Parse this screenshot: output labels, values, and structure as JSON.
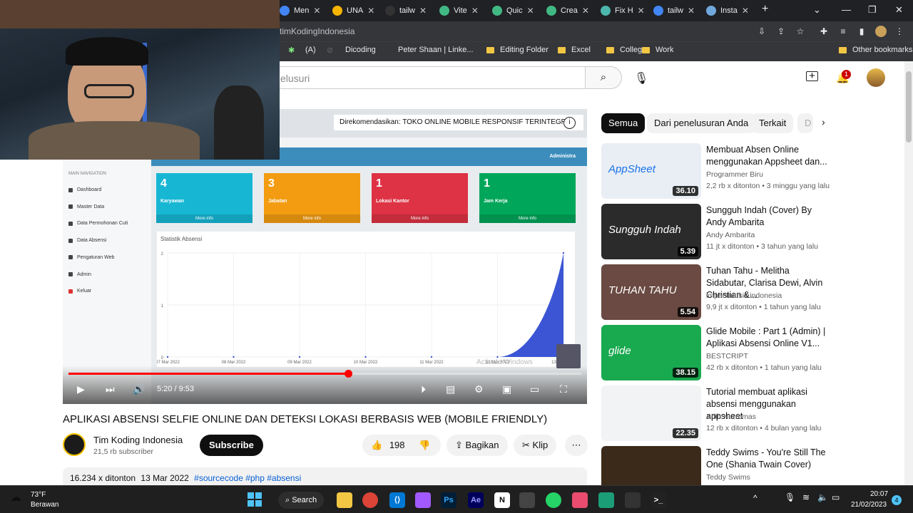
{
  "browser": {
    "tabs": [
      {
        "label": "Men",
        "color": "#4285f4"
      },
      {
        "label": "UNA",
        "color": "#f4b400"
      },
      {
        "label": "tailw",
        "color": "#333"
      },
      {
        "label": "Vite",
        "color": "#41b883"
      },
      {
        "label": "Quic",
        "color": "#41b883"
      },
      {
        "label": "Crea",
        "color": "#41b883"
      },
      {
        "label": "Fix H",
        "color": "#4db6ac"
      },
      {
        "label": "tailw",
        "color": "#4285f4"
      },
      {
        "label": "Insta",
        "color": "#6fa8dc"
      }
    ],
    "address": "timKodingIndonesia",
    "bookmarks": [
      "Dicoding",
      "Peter Shaan | Linke...",
      "Editing Folder",
      "Excel",
      "College",
      "Work",
      "Other bookmarks"
    ]
  },
  "youtube": {
    "search_placeholder": "elusuri",
    "notif_count": "1",
    "video": {
      "title": "APLIKASI ABSENSI SELFIE ONLINE DAN DETEKSI LOKASI BERBASIS WEB (MOBILE FRIENDLY)",
      "time": "5:20 / 9:53",
      "progress": 0.545,
      "recommend": "Direkomendasikan: TOKO ONLINE MOBILE RESPONSIF TERINTEGR...",
      "channel": "Tim Koding Indonesia",
      "subs": "21,5 rb subscriber",
      "subscribe": "Subscribe",
      "likes": "198",
      "share": "Bagikan",
      "clip": "Klip",
      "views": "16.234 x ditonton",
      "date": "13 Mar 2022",
      "tags": "#sourcecode #php #absensi"
    },
    "inner_app": {
      "menu_title": "MAIN NAVIGATION",
      "menu": [
        "Dashboard",
        "Master Data",
        "Data Permohonan Cuti",
        "Data Absensi",
        "Pengaturan Web",
        "Admin",
        "Keluar"
      ],
      "admin": "Administra",
      "boxes": [
        {
          "n": "4",
          "label": "Karyawan",
          "color": "#17b7d4"
        },
        {
          "n": "3",
          "label": "Jabatan",
          "color": "#f39c12"
        },
        {
          "n": "1",
          "label": "Lokasi Kantor",
          "color": "#dd3344"
        },
        {
          "n": "1",
          "label": "Jam Kerja",
          "color": "#00a65a"
        }
      ],
      "more": "More info",
      "chart_title": "Statistik Absensi",
      "windows_watermark": "Activate Windows"
    },
    "chips": [
      "Semua",
      "Dari penelusuran Anda",
      "Terkait",
      "D"
    ],
    "recs": [
      {
        "title": "Membuat Absen Online menggunakan Appsheet dan...",
        "channel": "Programmer Biru",
        "meta": "2,2 rb x ditonton  •  3 minggu yang lalu",
        "dur": "36.10",
        "bg": "#e9eef5",
        "label": "AppSheet"
      },
      {
        "title": "Sungguh Indah (Cover) By Andy Ambarita",
        "channel": "Andy Ambarita",
        "meta": "11 jt x ditonton  •  3 tahun yang lalu",
        "dur": "5.39",
        "bg": "#2b2b2b",
        "label": "Sungguh Indah"
      },
      {
        "title": "Tuhan Tahu - Melitha Sidabutar, Clarisa Dewi, Alvin Christian &...",
        "channel": "impactmusik indonesia",
        "meta": "9,9 jt x ditonton  •  1 tahun yang lalu",
        "dur": "5.54",
        "bg": "#6a4a42",
        "label": "TUHAN TAHU"
      },
      {
        "title": "Glide Mobile : Part 1 (Admin) | Aplikasi Absensi Online V1...",
        "channel": "BESTCRIPT",
        "meta": "42 rb x ditonton  •  1 tahun yang lalu",
        "dur": "38.15",
        "bg": "#19a94f",
        "label": "glide"
      },
      {
        "title": "Tutorial membuat aplikasi absensi menggunakan appsheet",
        "channel": "Adib Nurromas",
        "meta": "12 rb x ditonton  •  4 bulan yang lalu",
        "dur": "22.35",
        "bg": "#f1f3f4",
        "label": ""
      },
      {
        "title": "Teddy Swims - You're Still The One (Shania Twain Cover)",
        "channel": "Teddy Swims",
        "meta": "",
        "dur": "",
        "bg": "#3b2a1a",
        "label": ""
      }
    ]
  },
  "taskbar": {
    "temp": "73°F",
    "weather": "Berawan",
    "search": "Search",
    "time": "20:07",
    "date": "21/02/2023",
    "notif": "4"
  },
  "chart_data": {
    "type": "area",
    "title": "Statistik Absensi",
    "x": [
      "07 Mar 2022",
      "08 Mar 2022",
      "09 Mar 2022",
      "10 Mar 2022",
      "11 Mar 2022",
      "12 Mar 2022",
      "13 Mar 2022"
    ],
    "series": [
      {
        "values": [
          0,
          0,
          0,
          0,
          0,
          0,
          2
        ]
      }
    ],
    "ylim": [
      0,
      2
    ],
    "yticks": [
      0,
      1,
      2
    ],
    "color": "#3b55d4"
  }
}
